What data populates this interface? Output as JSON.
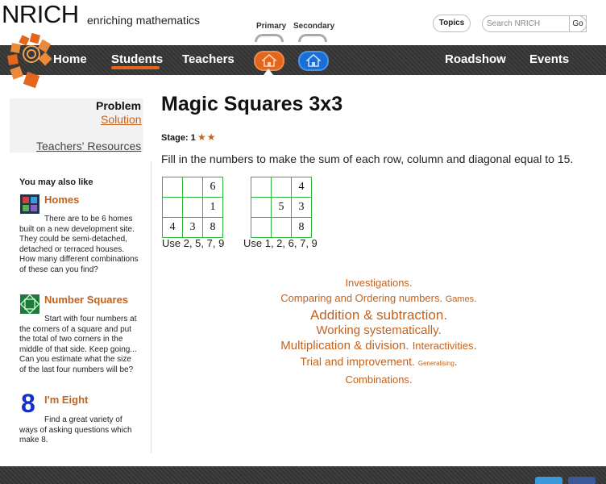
{
  "brand": {
    "name": "NRICH",
    "tagline": "enriching mathematics",
    "level_primary": "Primary",
    "level_secondary": "Secondary"
  },
  "header": {
    "topics_label": "Topics",
    "search_placeholder": "Search NRICH",
    "go_label": "Go"
  },
  "nav": {
    "home": "Home",
    "students": "Students",
    "teachers": "Teachers",
    "roadshow": "Roadshow",
    "events": "Events",
    "active": "Students",
    "primary_color": "#e3661b",
    "secondary_color": "#1a6fd6"
  },
  "problem_box": {
    "problem": "Problem",
    "solution": "Solution",
    "teachers_resources": "Teachers' Resources"
  },
  "sidebar": {
    "heading": "You may also like",
    "items": [
      {
        "title": "Homes",
        "icon": "homes-thumbnail-icon",
        "desc": "There are to be 6 homes built on a new development site. They could be semi-detached, detached or terraced houses. How many different combinations of these can you find?"
      },
      {
        "title": "Number Squares",
        "icon": "number-squares-thumbnail-icon",
        "desc": "Start with four numbers at the corners of a square and put the total of two corners in the middle of that side. Keep going... Can you estimate what the size of the last four numbers will be?"
      },
      {
        "title": "I'm Eight",
        "icon": "eight-thumbnail-icon",
        "icon_text": "8",
        "desc": "Find a great variety of ways of asking questions which make 8."
      }
    ]
  },
  "main": {
    "title": "Magic Squares 3x3",
    "stage_label": "Stage: 1",
    "stars": "★★",
    "instructions": "Fill in the numbers to make the sum of each row, column and diagonal equal to 15.",
    "grids": [
      {
        "cells": [
          "",
          "",
          "6",
          "",
          "",
          "1",
          "4",
          "3",
          "8"
        ],
        "caption": "Use 2, 5, 7, 9"
      },
      {
        "cells": [
          "",
          "",
          "4",
          "",
          "5",
          "3",
          "",
          "",
          "8"
        ],
        "caption": "Use 1, 2, 6, 7, 9"
      }
    ]
  },
  "tags": [
    [
      "Investigations"
    ],
    [
      "Comparing and Ordering numbers",
      "Games"
    ],
    [
      "Addition & subtraction"
    ],
    [
      "Working systematically"
    ],
    [
      "Multiplication & division",
      "Interactivities"
    ],
    [
      "Trial and improvement",
      "Generalising"
    ],
    [
      "Combinations"
    ]
  ]
}
